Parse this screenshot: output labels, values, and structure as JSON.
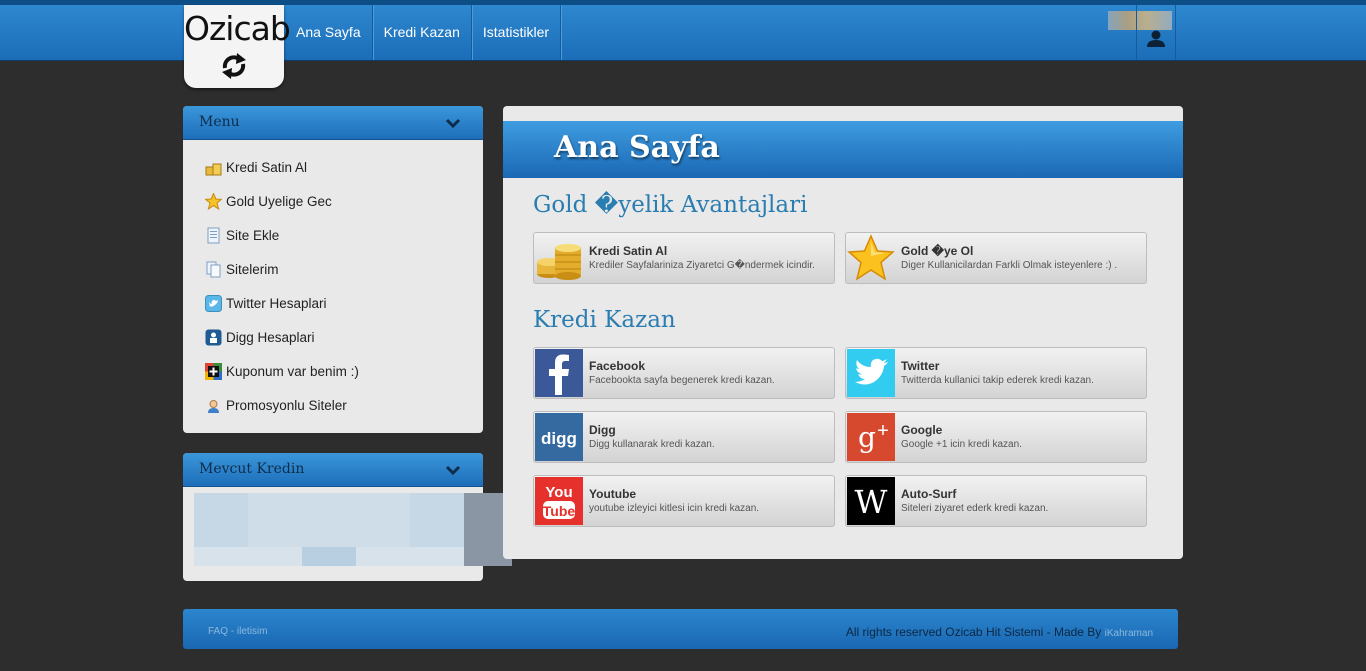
{
  "header": {
    "logo_text": "Ozicab",
    "logo_symbol": "⟲⟳",
    "nav": [
      "Ana Sayfa",
      "Kredi Kazan",
      "Istatistikler"
    ]
  },
  "sidebar": {
    "menu_title": "Menu",
    "items": [
      {
        "label": "Kredi Satin Al",
        "icon": "coins-icon"
      },
      {
        "label": "Gold Uyelige Gec",
        "icon": "star-icon"
      },
      {
        "label": "Site Ekle",
        "icon": "document-icon"
      },
      {
        "label": "Sitelerim",
        "icon": "documents-icon"
      },
      {
        "label": "Twitter Hesaplari",
        "icon": "twitter-icon"
      },
      {
        "label": "Digg Hesaplari",
        "icon": "digg-icon"
      },
      {
        "label": "Kuponum var benim :)",
        "icon": "plus-icon"
      },
      {
        "label": "Promosyonlu Siteler",
        "icon": "person-icon"
      }
    ],
    "credit_title": "Mevcut Kredin"
  },
  "main": {
    "title": "Ana Sayfa",
    "gold_section_title": "Gold �yelik Avantajlari",
    "gold_cards": [
      {
        "title": "Kredi Satin Al",
        "desc": "Krediler Sayfalariniza Ziyaretci G�ndermek icindir.",
        "icon": "coins-icon"
      },
      {
        "title": "Gold �ye Ol",
        "desc": "Diger Kullanicilardan Farkli Olmak isteyenlere :) .",
        "icon": "star-icon"
      }
    ],
    "earn_section_title": "Kredi Kazan",
    "earn_cards": [
      {
        "title": "Facebook",
        "desc": "Facebookta sayfa begenerek kredi kazan.",
        "icon": "facebook-icon",
        "color": "#3b5998"
      },
      {
        "title": "Twitter",
        "desc": "Twitterda kullanici takip ederek kredi kazan.",
        "icon": "twitter-icon",
        "color": "#33ccf1"
      },
      {
        "title": "Digg",
        "desc": "Digg kullanarak kredi kazan.",
        "icon": "digg-icon",
        "color": "#356aa0"
      },
      {
        "title": "Google",
        "desc": "Google +1 icin kredi kazan.",
        "icon": "google-plus-icon",
        "color": "#d6492f"
      },
      {
        "title": "Youtube",
        "desc": "youtube izleyici kitlesi icin kredi kazan.",
        "icon": "youtube-icon",
        "color": "#e5302b"
      },
      {
        "title": "Auto-Surf",
        "desc": "Siteleri ziyaret ederk kredi kazan.",
        "icon": "wikipedia-icon",
        "color": "#000000"
      }
    ]
  },
  "footer": {
    "faq": "FAQ",
    "separator": " - ",
    "contact": "iletisim",
    "rights": "All rights reserved Ozicab Hit Sistemi - Made By ",
    "author": "iKahraman"
  }
}
